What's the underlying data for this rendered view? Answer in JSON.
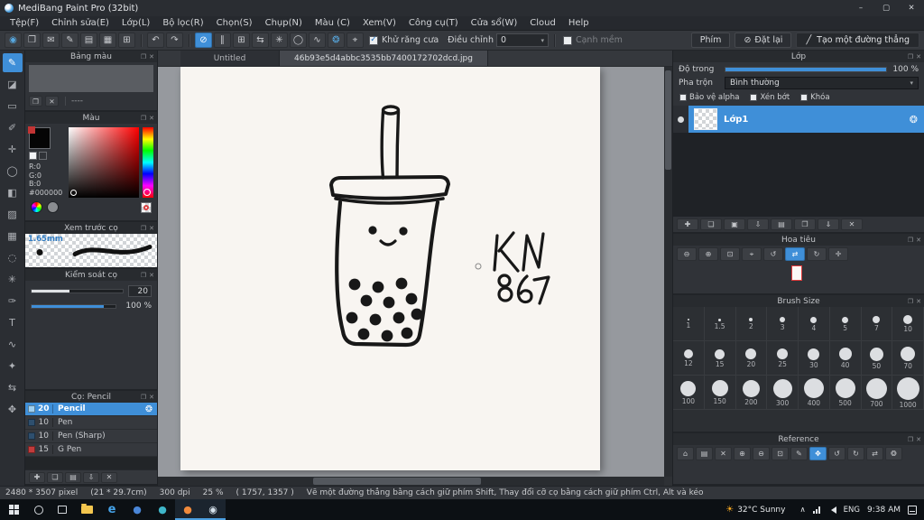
{
  "ui": {
    "popout_icon": "❐",
    "close_icon": "✕",
    "dropdown_arrow": "▾",
    "check_icon": "✓",
    "gear_icon": "❂"
  },
  "titlebar": {
    "title": "MediBang Paint Pro (32bit)",
    "minimize": "–",
    "maximize": "▢",
    "close": "✕"
  },
  "menubar": {
    "items": [
      "Tệp(F)",
      "Chỉnh sửa(E)",
      "Lớp(L)",
      "Bộ lọc(R)",
      "Chọn(S)",
      "Chụp(N)",
      "Màu (C)",
      "Xem(V)",
      "Công cụ(T)",
      "Cửa sổ(W)",
      "Cloud",
      "Help"
    ]
  },
  "toolbar": {
    "file_icons": [
      {
        "name": "medibang-brush",
        "glyph": "◉",
        "color": "#57a8e0"
      },
      {
        "name": "clipboard",
        "glyph": "❐"
      },
      {
        "name": "comment",
        "glyph": "✉"
      },
      {
        "name": "brush",
        "glyph": "✎"
      },
      {
        "name": "page",
        "glyph": "▤"
      },
      {
        "name": "panel-layout",
        "glyph": "▦"
      },
      {
        "name": "grid",
        "glyph": "⊞"
      }
    ],
    "history_icons": [
      {
        "name": "undo",
        "glyph": "↶"
      },
      {
        "name": "redo",
        "glyph": "↷"
      }
    ],
    "snap_icons": [
      {
        "name": "snap-off",
        "glyph": "⊘",
        "active": true
      },
      {
        "name": "snap-parallel",
        "glyph": "∥"
      },
      {
        "name": "snap-grid",
        "glyph": "⊞"
      },
      {
        "name": "snap-horizontal",
        "glyph": "⇆"
      },
      {
        "name": "snap-radial",
        "glyph": "✳"
      },
      {
        "name": "snap-circle",
        "glyph": "◯"
      },
      {
        "name": "snap-curve",
        "glyph": "∿"
      },
      {
        "name": "snap-settings",
        "glyph": "❂",
        "color": "#57a8e0"
      },
      {
        "name": "snap-display",
        "glyph": "⌖"
      }
    ],
    "antialias_label": "Khử răng cưa",
    "adjust_label": "Điều chỉnh",
    "adjust_value": "0",
    "soft_edge_label": "Cạnh mềm",
    "key_button_label": "Phím",
    "reset_icon": "⊘",
    "reset_button_label": "Đặt lại",
    "active_tool_icon": "╱",
    "active_tool_label": "Tạo một đường thẳng"
  },
  "left_tools": [
    {
      "name": "pen-tool",
      "glyph": "✎",
      "active": true
    },
    {
      "name": "eraser-tool",
      "glyph": "◪"
    },
    {
      "name": "rect-select-tool",
      "glyph": "▭"
    },
    {
      "name": "brush-tool",
      "glyph": "✐"
    },
    {
      "name": "move-tool",
      "glyph": "✛"
    },
    {
      "name": "zoom-tool",
      "glyph": "◯"
    },
    {
      "name": "bucket-tool",
      "glyph": "◧"
    },
    {
      "name": "gradient-tool",
      "glyph": "▨"
    },
    {
      "name": "marquee-tool",
      "glyph": "▦"
    },
    {
      "name": "lasso-tool",
      "glyph": "◌"
    },
    {
      "name": "magic-wand-tool",
      "glyph": "✳"
    },
    {
      "name": "select-pen-tool",
      "glyph": "✑"
    },
    {
      "name": "text-tool",
      "glyph": "T"
    },
    {
      "name": "curve-tool",
      "glyph": "∿"
    },
    {
      "name": "eyedropper-tool",
      "glyph": "✦"
    },
    {
      "name": "divide-tool",
      "glyph": "⇆"
    },
    {
      "name": "hand-tool",
      "glyph": "✥"
    }
  ],
  "left_panels": {
    "palette": {
      "title": "Bảng màu",
      "name_placeholder": "----"
    },
    "color": {
      "title": "Màu",
      "r": "R:0",
      "g": "G:0",
      "b": "B:0",
      "hex": "#000000"
    },
    "brush_preview": {
      "title": "Xem trước cọ",
      "size": "1.65mm"
    },
    "brush_control": {
      "title": "Kiểm soát cọ",
      "size_value": "20",
      "opacity_value": "100 %"
    },
    "brush_list": {
      "title": "Cọ: Pencil",
      "brushes": [
        {
          "size": "20",
          "name": "Pencil",
          "selected": true,
          "swatch": "#9fd0f0"
        },
        {
          "size": "10",
          "name": "Pen",
          "swatch": "#2e4f6e"
        },
        {
          "size": "10",
          "name": "Pen (Sharp)",
          "swatch": "#2e4f6e"
        },
        {
          "size": "15",
          "name": "G Pen",
          "swatch": "#c23b3b"
        }
      ],
      "buttons": [
        {
          "name": "add-brush",
          "glyph": "✚"
        },
        {
          "name": "duplicate-brush",
          "glyph": "❏"
        },
        {
          "name": "brush-folder",
          "glyph": "▤"
        },
        {
          "name": "save-brush",
          "glyph": "⇩"
        },
        {
          "name": "delete-brush",
          "glyph": "✕"
        }
      ]
    }
  },
  "right_panels": {
    "layers": {
      "title": "Lớp",
      "opacity_label": "Độ trong",
      "opacity_value": "100 %",
      "blend_label": "Pha trộn",
      "blend_value": "Bình thường",
      "checkboxes": [
        "Bảo vệ alpha",
        "Xén bớt",
        "Khóa"
      ],
      "layer_name": "Lớp1",
      "buttons": [
        {
          "name": "add-layer",
          "glyph": "✚"
        },
        {
          "name": "new-layer",
          "glyph": "❏"
        },
        {
          "name": "new-folder",
          "glyph": "▣"
        },
        {
          "name": "transfer-layer",
          "glyph": "⇩"
        },
        {
          "name": "layer-folder",
          "glyph": "▤"
        },
        {
          "name": "duplicate-layer",
          "glyph": "❐"
        },
        {
          "name": "merge-down",
          "glyph": "⇓"
        },
        {
          "name": "delete-layer",
          "glyph": "✕"
        }
      ]
    },
    "navigator": {
      "title": "Hoa tiêu",
      "buttons": [
        {
          "name": "zoom-out",
          "glyph": "⊖"
        },
        {
          "name": "zoom-in",
          "glyph": "⊕"
        },
        {
          "name": "fit-screen",
          "glyph": "⊡"
        },
        {
          "name": "zoom-reset",
          "glyph": "⌖"
        },
        {
          "name": "rotate-left",
          "glyph": "↺"
        },
        {
          "name": "flip-horizontal",
          "glyph": "⇄",
          "active": true
        },
        {
          "name": "rotate-right",
          "glyph": "↻"
        },
        {
          "name": "reset-view",
          "glyph": "✛"
        }
      ]
    },
    "brush_size": {
      "title": "Brush Size",
      "rows": [
        [
          1,
          1.5,
          2,
          3,
          4,
          5,
          7,
          10
        ],
        [
          12,
          15,
          20,
          25,
          30,
          40,
          50,
          70
        ],
        [
          100,
          150,
          200,
          300,
          400,
          500,
          700,
          1000
        ]
      ]
    },
    "reference": {
      "title": "Reference",
      "buttons": [
        {
          "name": "home",
          "glyph": "⌂"
        },
        {
          "name": "import-image",
          "glyph": "▤"
        },
        {
          "name": "close-image",
          "glyph": "✕"
        },
        {
          "name": "zoom-in",
          "glyph": "⊕"
        },
        {
          "name": "zoom-out",
          "glyph": "⊖"
        },
        {
          "name": "zoom-reset",
          "glyph": "⊡"
        },
        {
          "name": "eyedropper",
          "glyph": "✎"
        },
        {
          "name": "pan-hand",
          "glyph": "✥",
          "active": true
        },
        {
          "name": "rotate-left",
          "glyph": "↺"
        },
        {
          "name": "rotate-right",
          "glyph": "↻"
        },
        {
          "name": "flip-horizontal",
          "glyph": "⇄"
        },
        {
          "name": "settings",
          "glyph": "❂"
        }
      ]
    }
  },
  "canvas": {
    "tabs": [
      {
        "label": "Untitled",
        "active": false
      },
      {
        "label": "46b93e5d4abbc3535bb7400172702dcd.jpg",
        "active": true
      }
    ],
    "handwritten_text": "KN 867"
  },
  "statusbar": {
    "dimensions": "2480 * 3507 pixel",
    "print_size": "(21 * 29.7cm)",
    "dpi": "300 dpi",
    "zoom": "25 %",
    "cursor": "( 1757, 1357 )",
    "hint": "Vẽ một đường thẳng bằng cách giữ phím Shift, Thay đổi cỡ cọ bằng cách giữ phím Ctrl, Alt và kéo"
  },
  "taskbar": {
    "apps": [
      {
        "name": "file-explorer"
      },
      {
        "name": "edge-browser",
        "glyph": "e",
        "color": "#45a2e8",
        "bold": true
      },
      {
        "name": "app-blue",
        "glyph": "●",
        "color": "#4a86d8"
      },
      {
        "name": "app-teal",
        "glyph": "●",
        "color": "#3fb6c9"
      },
      {
        "name": "medibang-cloud",
        "glyph": "●",
        "color": "#f08a3c",
        "active": true
      },
      {
        "name": "medibang-paint",
        "glyph": "◉",
        "color": "#d8e4ee",
        "active": true
      }
    ],
    "weather_icon": "☀",
    "weather": "32°C Sunny",
    "tray_chevron": "∧",
    "language": "ENG",
    "time": "9:38 AM"
  }
}
